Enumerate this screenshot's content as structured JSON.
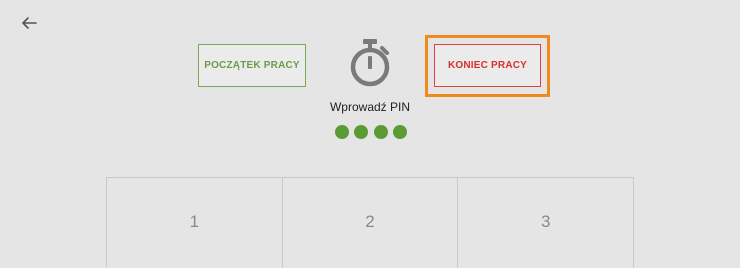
{
  "header": {
    "back_icon": "arrow-left-icon"
  },
  "actions": {
    "start_label": "POCZĄTEK PRACY",
    "end_label": "KONIEC PRACY"
  },
  "timer": {
    "icon": "stopwatch-icon"
  },
  "pin": {
    "label": "Wprowadź PIN",
    "entered_count": 4,
    "total": 4
  },
  "keypad": {
    "keys": [
      "1",
      "2",
      "3"
    ]
  },
  "colors": {
    "start": "#6b9d47",
    "end": "#d9302a",
    "highlight": "#f08a1c",
    "pin_dot": "#5c9b33"
  }
}
